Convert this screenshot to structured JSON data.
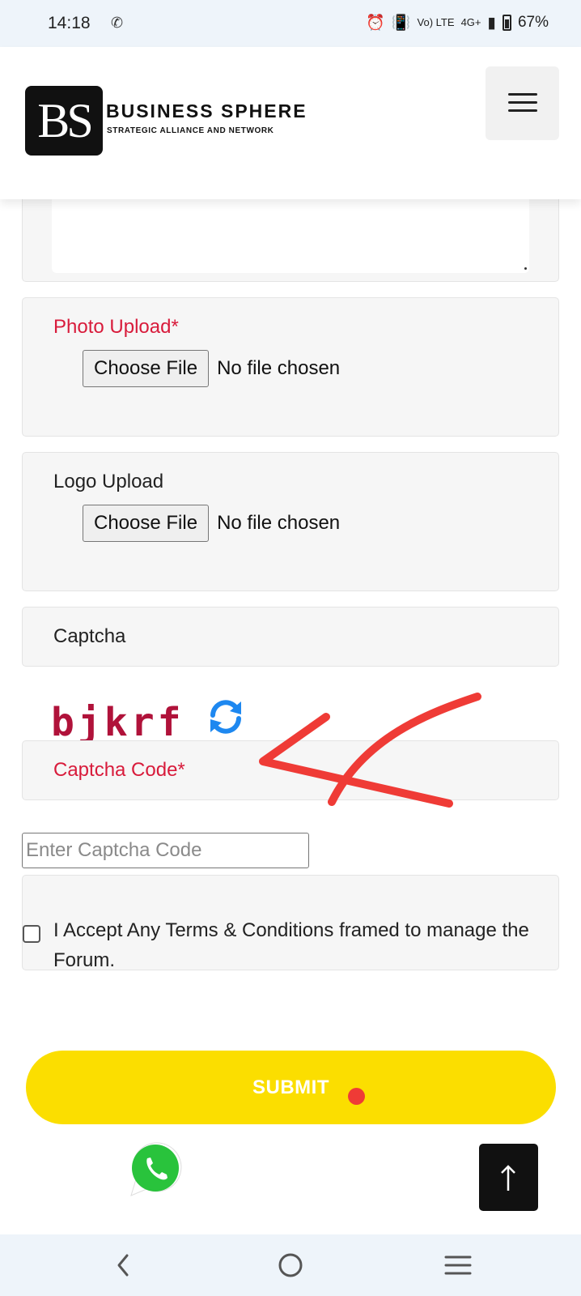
{
  "status_bar": {
    "time": "14:18",
    "signal_text": "4G+",
    "volte_text": "Vo) LTE",
    "battery": "67%"
  },
  "header": {
    "logo_mark": "BS",
    "logo_name": "BUSINESS SPHERE",
    "logo_tagline": "STRATEGIC ALLIANCE AND NETWORK",
    "menu_icon": "hamburger-icon"
  },
  "form": {
    "photo_upload": {
      "label": "Photo Upload*",
      "button": "Choose File",
      "status": "No file chosen"
    },
    "logo_upload": {
      "label": "Logo Upload",
      "button": "Choose File",
      "status": "No file chosen"
    },
    "captcha": {
      "label": "Captcha",
      "image_text": "bjkrf",
      "refresh_icon": "refresh-icon"
    },
    "captcha_code": {
      "label": "Captcha Code*",
      "placeholder": "Enter Captcha Code",
      "value": ""
    },
    "terms": {
      "text": "I Accept Any Terms & Conditions framed to manage the Forum.",
      "checked": false
    },
    "submit_label": "SUBMIT"
  },
  "floating": {
    "whatsapp_icon": "whatsapp-icon",
    "scroll_top_icon": "arrow-up-icon"
  },
  "colors": {
    "required_label": "#d81b3b",
    "submit_bg": "#fbde00",
    "annotation_arrow": "#ef3b36",
    "refresh_icon": "#1e88f0"
  },
  "nav_bar": {
    "back_icon": "back-icon",
    "home_icon": "home-icon",
    "recents_icon": "recents-icon"
  }
}
